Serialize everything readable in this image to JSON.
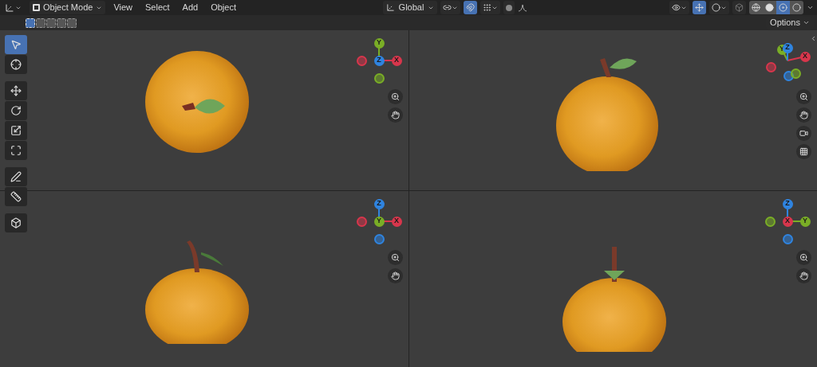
{
  "header": {
    "mode": "Object Mode",
    "menus": [
      "View",
      "Select",
      "Add",
      "Object"
    ],
    "orientation": "Global",
    "snap_on": true,
    "proportional_on": false,
    "gizmos_on": true,
    "xray_on": false,
    "shading": [
      {
        "kind": "wireframe",
        "selected": false
      },
      {
        "kind": "solid",
        "selected": false
      },
      {
        "kind": "material",
        "selected": true
      },
      {
        "kind": "rendered",
        "selected": false
      }
    ]
  },
  "tool_header": {
    "select_modes": [
      {
        "selected": true
      },
      {
        "selected": false
      },
      {
        "selected": false
      },
      {
        "selected": false
      },
      {
        "selected": false
      }
    ],
    "options": "Options"
  },
  "toolbar": [
    {
      "kind": "select-box",
      "selected": true
    },
    {
      "kind": "cursor",
      "selected": false
    },
    {
      "kind": "move",
      "selected": false
    },
    {
      "kind": "rotate",
      "selected": false
    },
    {
      "kind": "scale",
      "selected": false
    },
    {
      "kind": "transform",
      "selected": false
    },
    {
      "kind": "annotate",
      "selected": false
    },
    {
      "kind": "measure",
      "selected": false
    },
    {
      "kind": "add-cube",
      "selected": false
    }
  ],
  "viewports": [
    {
      "kind": "top",
      "axes": [
        {
          "label": "X",
          "color": "#d8364c"
        },
        {
          "label": "Y",
          "color": "#7aae26"
        },
        {
          "label": "Z",
          "color": "#2f84e0"
        }
      ]
    },
    {
      "kind": "perspective",
      "axes": [
        {
          "label": "X",
          "color": "#d8364c"
        },
        {
          "label": "Y",
          "color": "#7aae26"
        },
        {
          "label": "Z",
          "color": "#2f84e0"
        }
      ]
    },
    {
      "kind": "front",
      "axes": [
        {
          "label": "X",
          "color": "#d8364c"
        },
        {
          "label": "Y",
          "color": "#7aae26"
        },
        {
          "label": "Z",
          "color": "#2f84e0"
        }
      ]
    },
    {
      "kind": "right",
      "axes": [
        {
          "label": "X",
          "color": "#d8364c"
        },
        {
          "label": "Y",
          "color": "#7aae26"
        },
        {
          "label": "Z",
          "color": "#2f84e0"
        }
      ]
    }
  ]
}
